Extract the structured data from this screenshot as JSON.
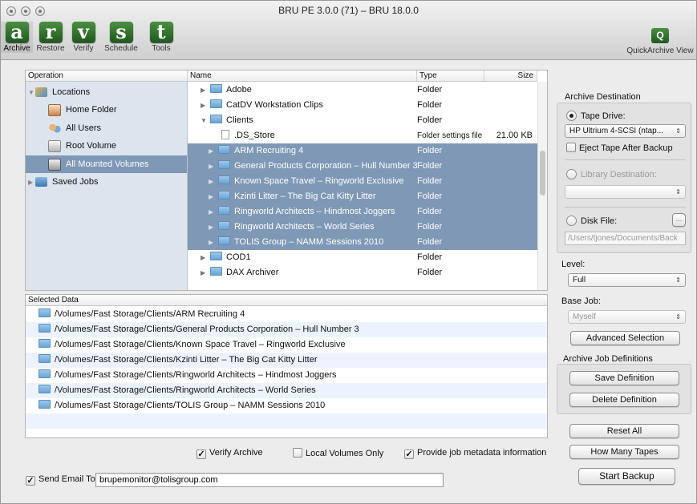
{
  "window": {
    "title": "BRU PE 3.0.0 (71) – BRU 18.0.0"
  },
  "toolbar": {
    "items": [
      {
        "letter": "a",
        "label": "Archive"
      },
      {
        "letter": "r",
        "label": "Restore"
      },
      {
        "letter": "v",
        "label": "Verify"
      },
      {
        "letter": "s",
        "label": "Schedule"
      },
      {
        "letter": "t",
        "label": "Tools"
      }
    ],
    "quick": {
      "letter": "Q",
      "label": "QuickArchive View"
    }
  },
  "sidebar": {
    "header": "Operation",
    "items": [
      {
        "label": "Locations",
        "icon": "locations-icon"
      },
      {
        "label": "Home Folder",
        "icon": "home-icon"
      },
      {
        "label": "All Users",
        "icon": "users-icon"
      },
      {
        "label": "Root Volume",
        "icon": "drive-icon"
      },
      {
        "label": "All Mounted Volumes",
        "icon": "volumes-icon"
      },
      {
        "label": "Saved Jobs",
        "icon": "saved-jobs-icon"
      }
    ]
  },
  "files": {
    "columns": {
      "name": "Name",
      "type": "Type",
      "size": "Size"
    },
    "rows": [
      {
        "name": "Adobe",
        "type": "Folder",
        "size": ""
      },
      {
        "name": "CatDV Workstation Clips",
        "type": "Folder",
        "size": ""
      },
      {
        "name": "Clients",
        "type": "Folder",
        "size": ""
      },
      {
        "name": ".DS_Store",
        "type": "Folder settings file",
        "size": "21.00 KB"
      },
      {
        "name": "ARM Recruiting 4",
        "type": "Folder",
        "size": ""
      },
      {
        "name": "General Products Corporation – Hull Number 3",
        "type": "Folder",
        "size": ""
      },
      {
        "name": "Known Space Travel – Ringworld Exclusive",
        "type": "Folder",
        "size": ""
      },
      {
        "name": "Kzinti Litter – The Big Cat Kitty Litter",
        "type": "Folder",
        "size": ""
      },
      {
        "name": "Ringworld Architects – Hindmost Joggers",
        "type": "Folder",
        "size": ""
      },
      {
        "name": "Ringworld Architects – World Series",
        "type": "Folder",
        "size": ""
      },
      {
        "name": "TOLIS Group – NAMM Sessions 2010",
        "type": "Folder",
        "size": ""
      },
      {
        "name": "COD1",
        "type": "Folder",
        "size": ""
      },
      {
        "name": "DAX Archiver",
        "type": "Folder",
        "size": ""
      }
    ]
  },
  "selected_data": {
    "header": "Selected Data",
    "rows": [
      "/Volumes/Fast Storage/Clients/ARM Recruiting 4",
      "/Volumes/Fast Storage/Clients/General Products Corporation – Hull Number 3",
      "/Volumes/Fast Storage/Clients/Known Space Travel – Ringworld Exclusive",
      "/Volumes/Fast Storage/Clients/Kzinti Litter – The Big Cat Kitty Litter",
      "/Volumes/Fast Storage/Clients/Ringworld Architects – Hindmost Joggers",
      "/Volumes/Fast Storage/Clients/Ringworld Architects – World Series",
      "/Volumes/Fast Storage/Clients/TOLIS Group – NAMM Sessions 2010"
    ]
  },
  "options": {
    "verify_archive": "Verify Archive",
    "local_volumes_only": "Local Volumes Only",
    "provide_metadata": "Provide job metadata information",
    "send_email_label": "Send Email To:",
    "send_email_value": "brupemonitor@tolisgroup.com"
  },
  "right_panel": {
    "archive_destination": "Archive Destination",
    "tape_drive": "Tape Drive:",
    "tape_drive_value": "HP Ultrium 4-SCSI (ntap...",
    "eject_tape": "Eject Tape After Backup",
    "library_destination": "Library Destination:",
    "disk_file": "Disk File:",
    "disk_file_path": "/Users/tjones/Documents/Back",
    "browse_button": "...",
    "level_label": "Level:",
    "level_value": "Full",
    "base_job_label": "Base Job:",
    "base_job_value": "Myself",
    "advanced_selection": "Advanced Selection",
    "job_definitions": "Archive Job Definitions",
    "save_definition": "Save Definition",
    "delete_definition": "Delete Definition",
    "reset_all": "Reset All",
    "how_many_tapes": "How Many Tapes",
    "start_backup": "Start Backup"
  },
  "colors": {
    "selection": "#7e98b6",
    "sidebar_bg": "#dce4ee",
    "toolbar_tile": "#2f6e2a",
    "alt_row": "#edf3fe"
  }
}
